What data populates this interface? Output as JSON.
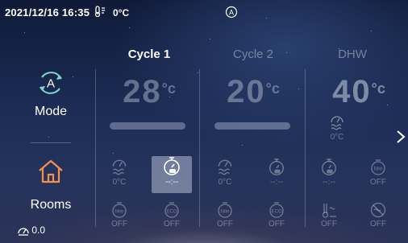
{
  "status_bar": {
    "datetime": "2021/12/16 16:35",
    "outdoor_temp": "0°C"
  },
  "nav": {
    "mode_label": "Mode",
    "mode_icon_letter": "A",
    "rooms_label": "Rooms",
    "energy_value": "0.0"
  },
  "zones": [
    {
      "title": "Cycle 1",
      "temp": "28",
      "unit": "°c"
    },
    {
      "title": "Cycle 2",
      "temp": "20",
      "unit": "°c"
    },
    {
      "title": "DHW",
      "temp": "40",
      "unit": "°c"
    }
  ],
  "tiles": {
    "dhw_heat_value": "0°C",
    "c1_temp_value": "0°C",
    "c1_timer_value": "--:--",
    "c1_silent_value": "OFF",
    "c1_eco_value": "OFF",
    "c2_temp_value": "0°C",
    "c2_timer_value": "--:--",
    "c2_silent_value": "OFF",
    "c2_eco_value": "OFF",
    "dhw_timer_value": "--:--",
    "dhw_silent_value": "OFF",
    "dhw_tank_value": "OFF",
    "dhw_disinfect_value": "OFF"
  },
  "colors": {
    "background_top": "#0f1a38",
    "background_bottom": "#2b3358",
    "accent_icon": "#7fd6d0",
    "rooms_icon": "#f2914a"
  },
  "icons": [
    "home-icon",
    "auto-mode-icon",
    "thermometer-icon",
    "timer-icon",
    "silent-icon",
    "eco-icon",
    "chevron-right-icon"
  ]
}
